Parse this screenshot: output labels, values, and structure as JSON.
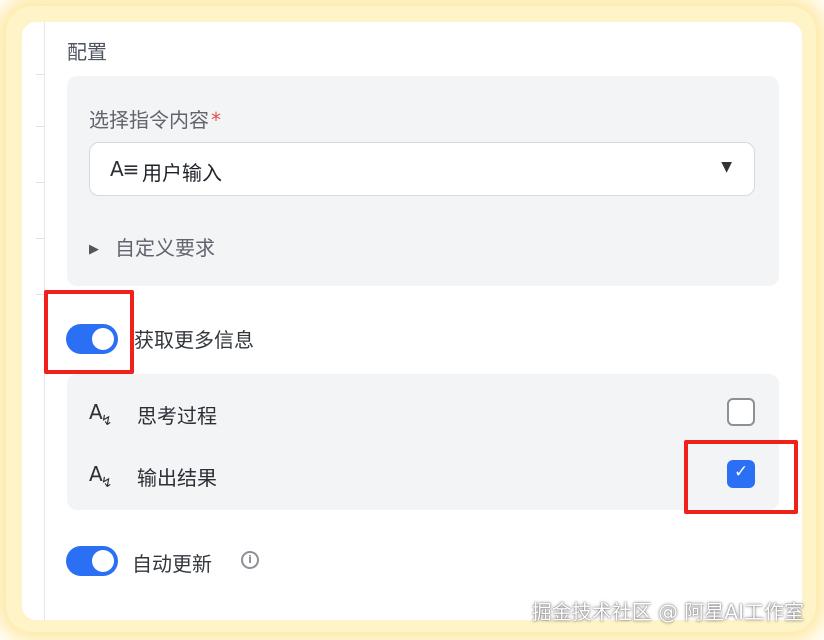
{
  "config": {
    "title": "配置",
    "instruction": {
      "label": "选择指令内容",
      "required_mark": "*",
      "selected_value": "用户输入",
      "value_icon": "text-format-icon"
    },
    "custom_requirements": {
      "label": "自定义要求",
      "expanded": false
    }
  },
  "more_info": {
    "toggle_on": true,
    "label": "获取更多信息",
    "options": [
      {
        "label": "思考过程",
        "icon": "ai-text-icon",
        "checked": false
      },
      {
        "label": "输出结果",
        "icon": "ai-text-icon",
        "checked": true
      }
    ]
  },
  "auto_update": {
    "toggle_on": true,
    "label": "自动更新",
    "info_icon": "info-icon"
  },
  "watermark": "掘金技术社区 @ 阿星AI工作室",
  "colors": {
    "accent": "#2b6ff5",
    "highlight": "#f0201b",
    "panel_bg": "#f3f4f6",
    "required": "#e34d4d"
  }
}
